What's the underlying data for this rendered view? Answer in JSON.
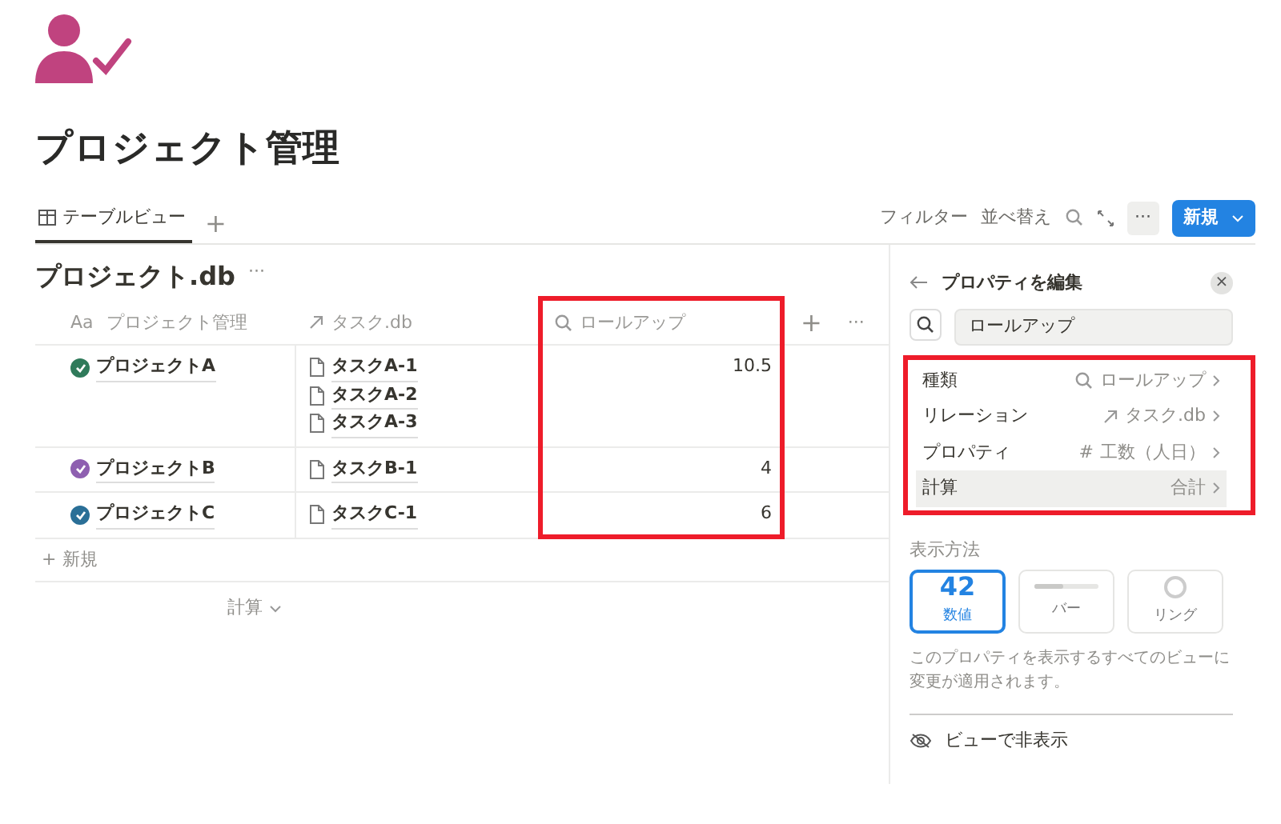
{
  "page": {
    "title": "プロジェクト管理"
  },
  "views": {
    "tabs": [
      {
        "label": "テーブルビュー",
        "selected": true
      }
    ],
    "add": "+"
  },
  "toolbar": {
    "filter": "フィルター",
    "sort": "並べ替え",
    "more": "···",
    "new_button": "新規"
  },
  "database": {
    "title": "プロジェクト.db",
    "more": "···",
    "columns": [
      {
        "label": "プロジェクト管理",
        "kind": "title",
        "type_mark": "Aa"
      },
      {
        "label": "タスク.db",
        "kind": "relation"
      },
      {
        "label": "ロールアップ",
        "kind": "rollup",
        "highlighted": true
      }
    ],
    "column_add": "+",
    "column_more": "···",
    "rows": [
      {
        "name": "プロジェクトA",
        "color": "#2f7a5a",
        "tasks": [
          "タスクA-1",
          "タスクA-2",
          "タスクA-3"
        ],
        "rollup": "10.5"
      },
      {
        "name": "プロジェクトB",
        "color": "#8e5fb0",
        "tasks": [
          "タスクB-1"
        ],
        "rollup": "4"
      },
      {
        "name": "プロジェクトC",
        "color": "#2a6f97",
        "tasks": [
          "タスクC-1"
        ],
        "rollup": "6"
      }
    ],
    "new_row_icon": "+",
    "new_row": "新規",
    "calc": "計算"
  },
  "panel": {
    "title": "プロパティを編集",
    "close": "×",
    "name_value": "ロールアップ",
    "settings_highlighted": true,
    "settings": [
      {
        "kind": "type",
        "label": "種類",
        "value": "ロールアップ",
        "selected": false
      },
      {
        "kind": "relation",
        "label": "リレーション",
        "value": "タスク.db",
        "selected": false
      },
      {
        "kind": "property",
        "label": "プロパティ",
        "value_mark": "#",
        "value": "工数（人日）",
        "selected": false
      },
      {
        "kind": "calculation",
        "label": "計算",
        "value": "合計",
        "selected": true
      }
    ],
    "display_label": "表示方法",
    "display_options": [
      {
        "kind": "number",
        "preview": "42",
        "label": "数値",
        "selected": true
      },
      {
        "kind": "bar",
        "label": "バー",
        "selected": false
      },
      {
        "kind": "ring",
        "label": "リング",
        "selected": false
      }
    ],
    "note": "このプロパティを表示するすべてのビューに変更が適用されます。",
    "actions": [
      {
        "label": "ビューで非表示"
      }
    ]
  }
}
